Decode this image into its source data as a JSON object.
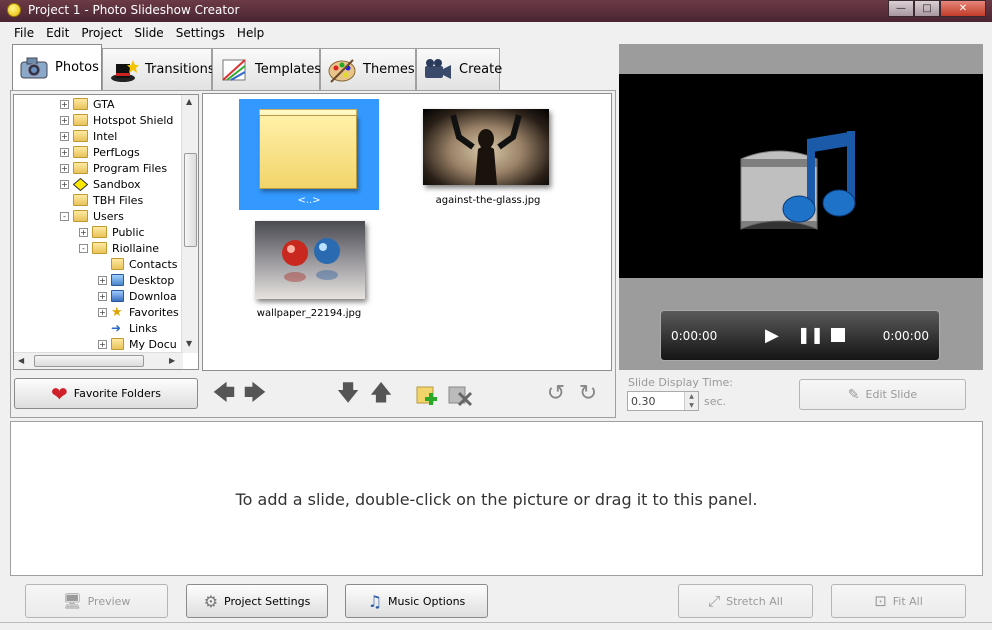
{
  "window": {
    "title": "Project 1 - Photo Slideshow Creator",
    "controls": {
      "minimize": "—",
      "maximize": "□",
      "close": "✕"
    }
  },
  "menu": [
    "File",
    "Edit",
    "Project",
    "Slide",
    "Settings",
    "Help"
  ],
  "tabs": [
    {
      "label": "Photos",
      "icon": "camera-icon",
      "active": true
    },
    {
      "label": "Transitions",
      "icon": "magic-hat-icon",
      "active": false
    },
    {
      "label": "Templates",
      "icon": "ruler-drawing-icon",
      "active": false
    },
    {
      "label": "Themes",
      "icon": "palette-icon",
      "active": false
    },
    {
      "label": "Create",
      "icon": "video-camera-icon",
      "active": false
    }
  ],
  "tree": [
    {
      "label": "GTA",
      "depth": 0,
      "expander": "+"
    },
    {
      "label": "Hotspot Shield",
      "depth": 0,
      "expander": "+"
    },
    {
      "label": "Intel",
      "depth": 0,
      "expander": "+"
    },
    {
      "label": "PerfLogs",
      "depth": 0,
      "expander": "+"
    },
    {
      "label": "Program Files",
      "depth": 0,
      "expander": "+"
    },
    {
      "label": "Sandbox",
      "depth": 0,
      "expander": "+"
    },
    {
      "label": "TBH Files",
      "depth": 0,
      "expander": ""
    },
    {
      "label": "Users",
      "depth": 0,
      "expander": "-"
    },
    {
      "label": "Public",
      "depth": 1,
      "expander": "+"
    },
    {
      "label": "Riollaine",
      "depth": 1,
      "expander": "-"
    },
    {
      "label": "Contacts",
      "depth": 2,
      "expander": ""
    },
    {
      "label": "Desktop",
      "depth": 2,
      "expander": "+"
    },
    {
      "label": "Downloa",
      "depth": 2,
      "expander": "+"
    },
    {
      "label": "Favorites",
      "depth": 2,
      "expander": "+"
    },
    {
      "label": "Links",
      "depth": 2,
      "expander": ""
    },
    {
      "label": "My Docu",
      "depth": 2,
      "expander": "+"
    }
  ],
  "thumbnails": [
    {
      "caption": "<..>",
      "type": "parent-folder",
      "selected": true
    },
    {
      "caption": "against-the-glass.jpg",
      "type": "image",
      "selected": false
    },
    {
      "caption": "wallpaper_22194.jpg",
      "type": "image",
      "selected": false
    }
  ],
  "buttons": {
    "favorite_folders": "Favorite Folders",
    "edit_slide": "Edit Slide",
    "preview": "Preview",
    "project_settings": "Project Settings",
    "music_options": "Music Options",
    "stretch_all": "Stretch All",
    "fit_all": "Fit All"
  },
  "player": {
    "elapsed": "0:00:00",
    "total": "0:00:00"
  },
  "slide_display": {
    "label": "Slide Display Time:",
    "value": "0.30",
    "unit": "sec."
  },
  "slide_panel": {
    "hint": "To add a slide, double-click on the picture or drag it to this panel."
  },
  "colors": {
    "titlebar": "#5a2f3c",
    "selection": "#3399ff",
    "preview_bg": "#000000"
  }
}
